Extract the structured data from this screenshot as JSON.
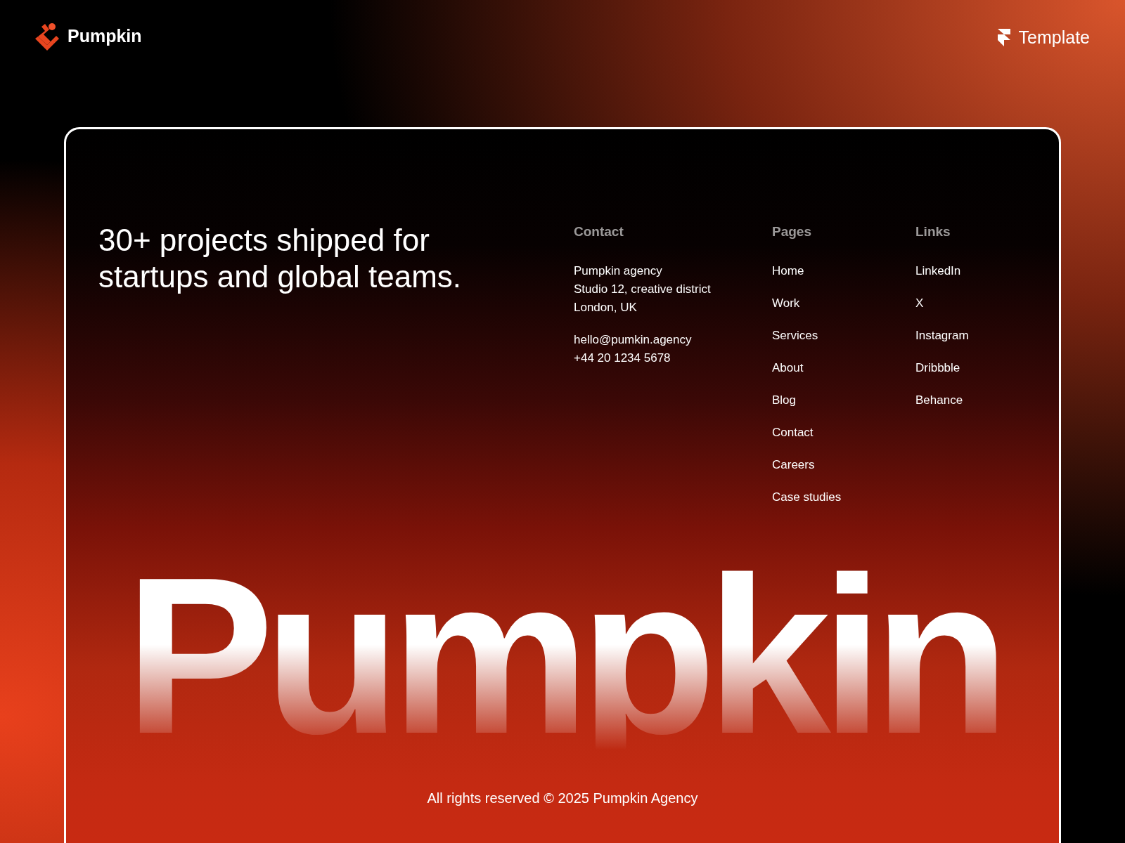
{
  "brand": {
    "name": "Pumpkin"
  },
  "template_badge": {
    "label": "Template"
  },
  "headline": "30+ projects shipped for startups and global teams.",
  "contact": {
    "title": "Contact",
    "address_lines": [
      "Pumpkin agency",
      "Studio 12, creative district",
      "London, UK"
    ],
    "email": "hello@pumkin.agency",
    "phone": "+44 20 1234 5678"
  },
  "pages": {
    "title": "Pages",
    "items": [
      "Home",
      "Work",
      "Services",
      "About",
      "Blog",
      "Contact",
      "Careers",
      "Case studies"
    ]
  },
  "links": {
    "title": "Links",
    "items": [
      "LinkedIn",
      "X",
      "Instagram",
      "Dribbble",
      "Behance"
    ]
  },
  "wordmark": "Pumpkin",
  "copyright": "All rights reserved © 2025 Pumpkin Agency"
}
